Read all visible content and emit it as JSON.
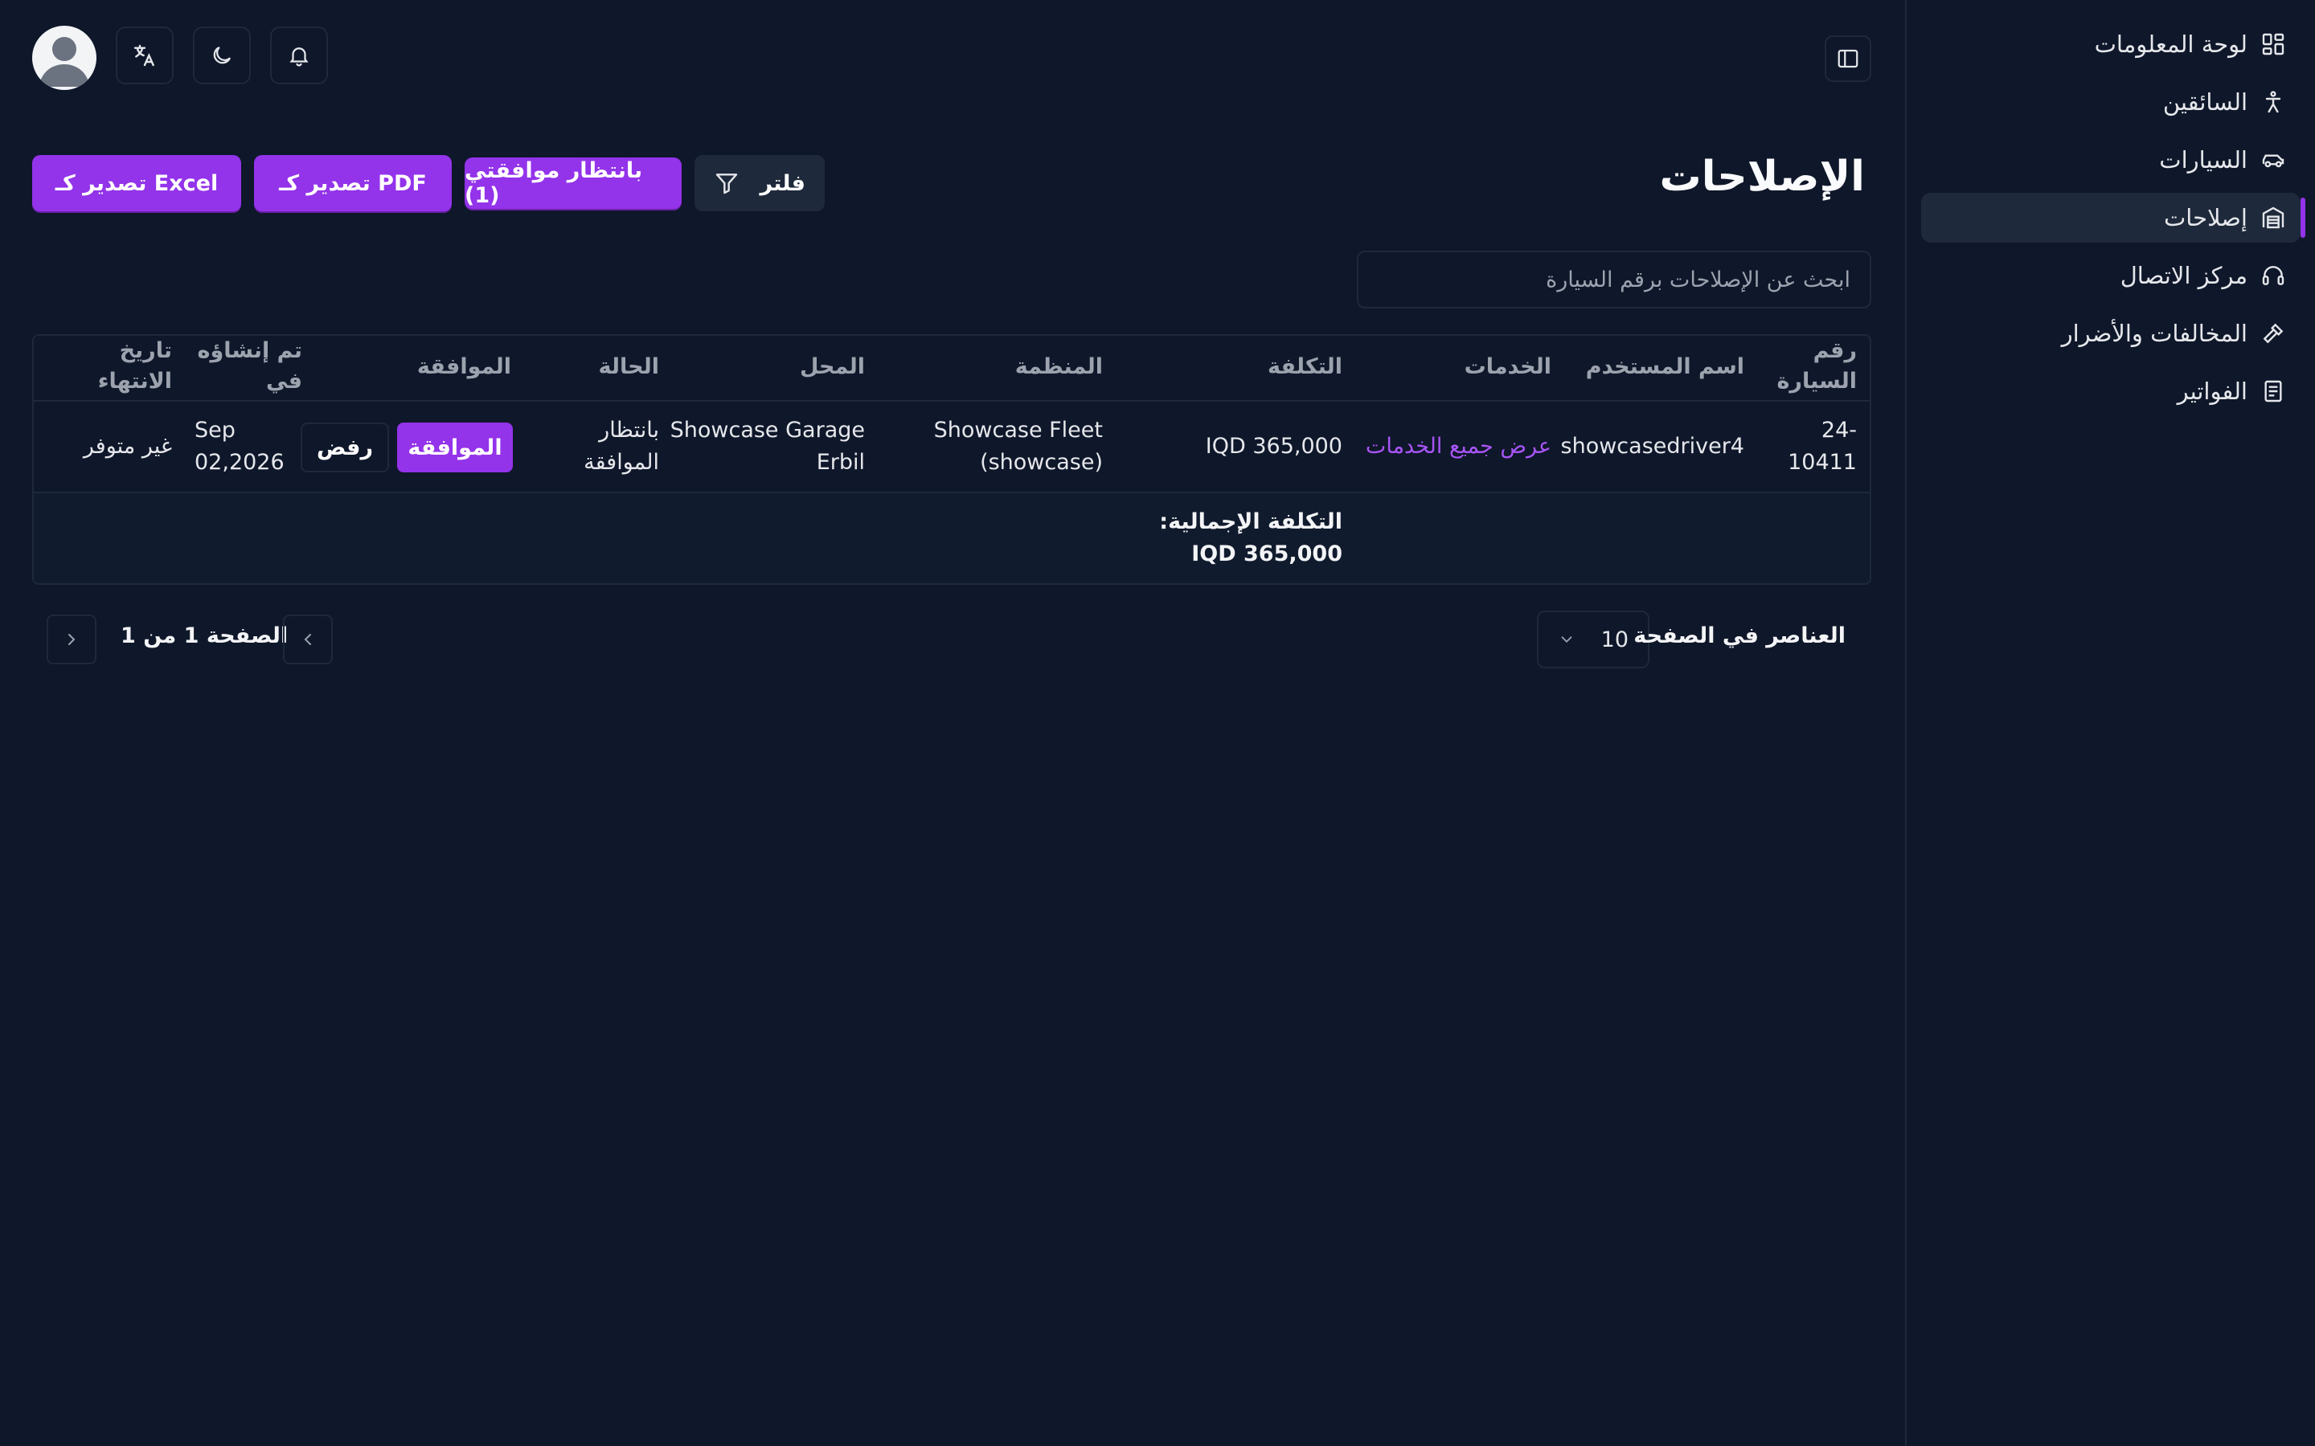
{
  "sidebar": {
    "items": [
      {
        "label": "لوحة المعلومات",
        "icon": "dashboard-icon"
      },
      {
        "label": "السائقين",
        "icon": "person-icon"
      },
      {
        "label": "السيارات",
        "icon": "car-icon"
      },
      {
        "label": "إصلاحات",
        "icon": "garage-icon",
        "active": true
      },
      {
        "label": "مركز الاتصال",
        "icon": "headset-icon"
      },
      {
        "label": "المخالفات والأضرار",
        "icon": "hammer-icon"
      },
      {
        "label": "الفواتير",
        "icon": "invoice-icon"
      }
    ]
  },
  "header": {
    "icons": [
      "notification-icon",
      "dark-mode-icon",
      "translate-icon",
      "avatar"
    ]
  },
  "page": {
    "title": "الإصلاحات",
    "filter_label": "فلتر",
    "pending_label": "بانتظار موافقتي (1)",
    "export_pdf_label": "تصدير كـ PDF",
    "export_excel_label": "تصدير كـ Excel",
    "search_placeholder": "ابحث عن الإصلاحات برقم السيارة"
  },
  "table": {
    "headers": {
      "car_number_1": "رقم",
      "car_number_2": "السيارة",
      "username": "اسم المستخدم",
      "services": "الخدمات",
      "cost": "التكلفة",
      "organization": "المنظمة",
      "shop": "المحل",
      "status": "الحالة",
      "approval": "الموافقة",
      "created_1": "تم إنشاؤه",
      "created_2": "في",
      "expiry_1": "تاريخ",
      "expiry_2": "الانتهاء"
    },
    "rows": [
      {
        "car_number_1": "-24",
        "car_number_2": "10411",
        "username": "showcasedriver4",
        "services": "عرض جميع الخدمات",
        "cost": "IQD 365,000",
        "organization_1": "Showcase Fleet",
        "organization_2": "(showcase)",
        "shop_1": "Showcase Garage",
        "shop_2": "Erbil",
        "status_1": "بانتظار",
        "status_2": "الموافقة",
        "approve_label": "الموافقة",
        "reject_label": "رفض",
        "created_1": "Sep",
        "created_2": "02,2026",
        "expiry": "غير متوفر"
      }
    ],
    "footer": {
      "total_label": "التكلفة الإجمالية:",
      "total_value": "IQD 365,000"
    }
  },
  "pagination": {
    "page_label": "الصفحة 1 من 1",
    "per_page_label": "العناصر في الصفحة",
    "per_page_value": "10"
  },
  "colors": {
    "background": "#0f172a",
    "accent": "#9333ea",
    "link": "#a855f7"
  }
}
